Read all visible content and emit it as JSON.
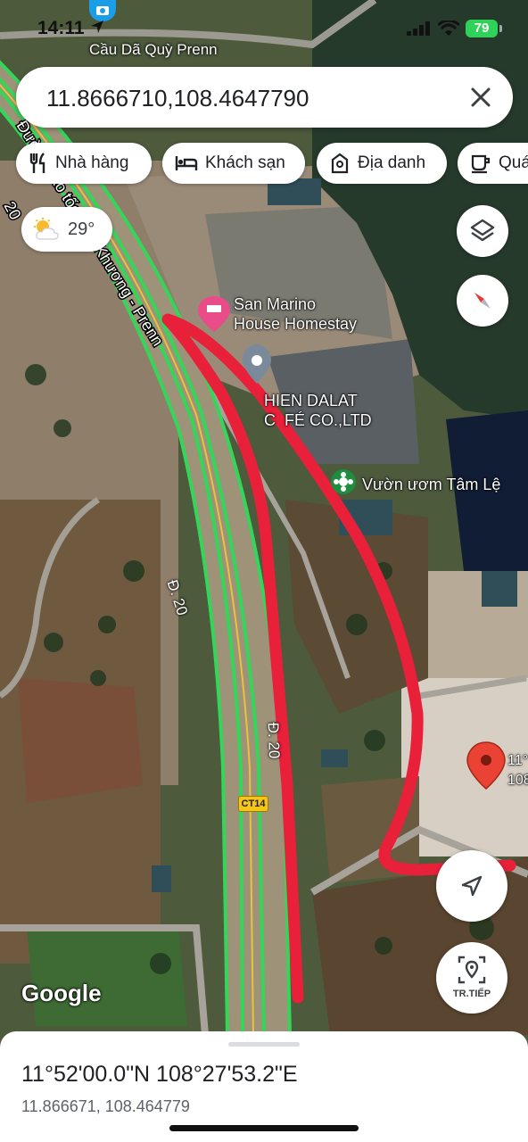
{
  "status_bar": {
    "time": "14:11",
    "battery": "79"
  },
  "top_place_label": "Cầu Dã Quỳ Prenn",
  "search": {
    "query": "11.8666710,108.4647790"
  },
  "chips": [
    {
      "label": "Nhà hàng",
      "icon": "fork-knife-icon"
    },
    {
      "label": "Khách sạn",
      "icon": "bed-icon"
    },
    {
      "label": "Địa danh",
      "icon": "landmark-icon"
    },
    {
      "label": "Quá",
      "icon": "cafe-icon"
    }
  ],
  "weather": {
    "temperature": "29°",
    "icon": "partly-sunny-icon"
  },
  "map": {
    "places": {
      "san_marino": "San Marino\nHouse Homestay",
      "thien_dalat": "HIEN DALAT\nC  FÉ CO.,LTD",
      "vuon_uom": "Vườn ươm Tâm Lệ",
      "pin_coords": "11°\n108"
    },
    "roads": {
      "highway_name": "Đường cao tốc Liên Khương - Prenn",
      "highway_number": "20",
      "d20_a": "Đ. 20",
      "d20_b": "Đ. 20",
      "ct_shield": "CT14"
    },
    "attribution": "Google",
    "colors": {
      "traffic": "#34d65a",
      "annotation": "#e8203a",
      "pin": "#ea4335"
    }
  },
  "buttons": {
    "next_label": "TR.TIẾP"
  },
  "bottom_sheet": {
    "dms": "11°52'00.0\"N 108°27'53.2\"E",
    "decimal": "11.866671, 108.464779"
  }
}
